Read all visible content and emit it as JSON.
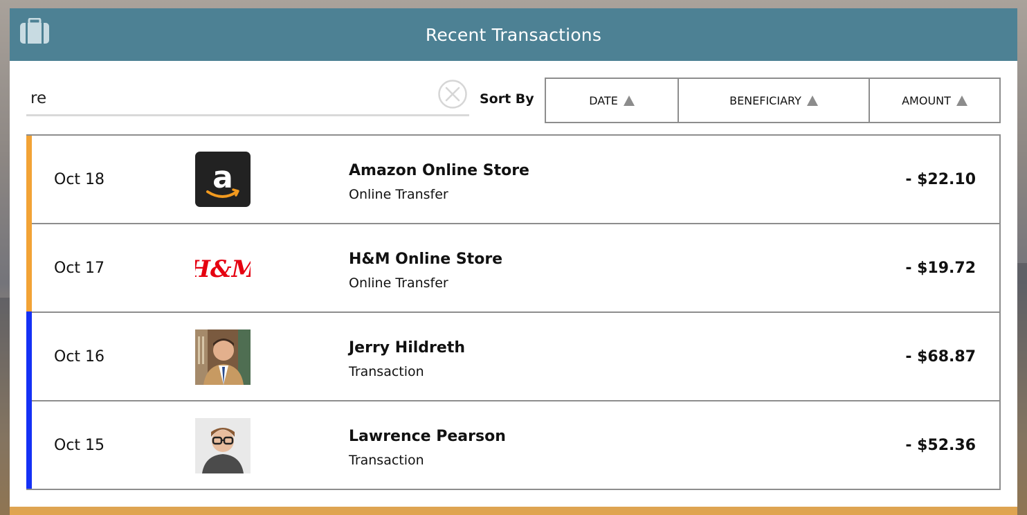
{
  "header": {
    "title": "Recent Transactions",
    "icon": "briefcase-icon"
  },
  "search": {
    "value": "re",
    "placeholder": ""
  },
  "sort": {
    "label": "Sort By",
    "options": [
      {
        "label": "DATE",
        "icon": "sort-asc-icon"
      },
      {
        "label": "BENEFICIARY",
        "icon": "sort-asc-icon"
      },
      {
        "label": "AMOUNT",
        "icon": "sort-asc-icon"
      }
    ]
  },
  "transactions": [
    {
      "date": "Oct 18",
      "name": "Amazon Online Store",
      "type": "Online Transfer",
      "amount": "- $22.10",
      "logo": "amazon-logo",
      "accent": "#f2a336"
    },
    {
      "date": "Oct 17",
      "name": "H&M Online Store",
      "type": "Online Transfer",
      "amount": "- $19.72",
      "logo": "hm-logo",
      "accent": "#f2a336"
    },
    {
      "date": "Oct 16",
      "name": "Jerry Hildreth",
      "type": "Transaction",
      "amount": "- $68.87",
      "logo": "avatar",
      "accent": "#1531f5"
    },
    {
      "date": "Oct 15",
      "name": "Lawrence Pearson",
      "type": "Transaction",
      "amount": "- $52.36",
      "logo": "avatar",
      "accent": "#1531f5"
    }
  ],
  "logos": {
    "hm_text": "H&M"
  },
  "colors": {
    "header": "#4d8194",
    "accent_orange": "#f2a336",
    "accent_blue": "#1531f5",
    "hm_red": "#e50010"
  }
}
